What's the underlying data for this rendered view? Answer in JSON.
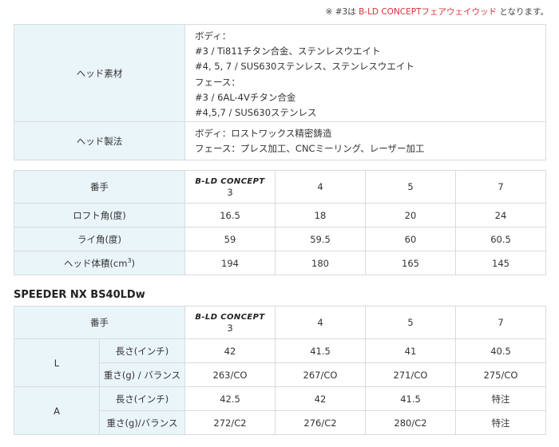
{
  "note": {
    "prefix": "※ #3は ",
    "highlight": "B-LD CONCEPTフェアウェイウッド",
    "suffix": " となります。"
  },
  "spec_table": {
    "rows": [
      {
        "label": "ヘッド素材",
        "lines": [
          "ボディ：",
          "#3 / Ti811チタン合金、ステンレスウエイト",
          "#4, 5, 7 / SUS630ステンレス、ステンレスウエイト",
          "フェース：",
          "#3 / 6AL-4Vチタン合金",
          "#4,5,7 / SUS630ステンレス"
        ]
      },
      {
        "label": "ヘッド製法",
        "lines": [
          "ボディ：ロストワックス精密鋳造",
          "フェース：プレス加工、CNCミーリング、レーザー加工"
        ]
      }
    ]
  },
  "head_table": {
    "header_label": "番手",
    "logo_text": "B-LD CONCEPT",
    "columns": [
      "3",
      "4",
      "5",
      "7"
    ],
    "rows": [
      {
        "label": "ロフト角(度)",
        "values": [
          "16.5",
          "18",
          "20",
          "24"
        ]
      },
      {
        "label": "ライ角(度)",
        "values": [
          "59",
          "59.5",
          "60",
          "60.5"
        ]
      },
      {
        "label_prefix": "ヘッド体積(cm",
        "label_sup": "3",
        "label_suffix": ")",
        "values": [
          "194",
          "180",
          "165",
          "145"
        ]
      }
    ]
  },
  "shaft_section": {
    "title": "SPEEDER NX BS40LDw",
    "header_label": "番手",
    "logo_text": "B-LD CONCEPT",
    "columns": [
      "3",
      "4",
      "5",
      "7"
    ],
    "groups": [
      {
        "flex": "L",
        "rows": [
          {
            "label": "長さ(インチ)",
            "values": [
              "42",
              "41.5",
              "41",
              "40.5"
            ]
          },
          {
            "label": "重さ(g) / バランス",
            "values": [
              "263/CO",
              "267/CO",
              "271/CO",
              "275/CO"
            ]
          }
        ]
      },
      {
        "flex": "A",
        "rows": [
          {
            "label": "長さ(インチ)",
            "values": [
              "42.5",
              "42",
              "41.5",
              "特注"
            ]
          },
          {
            "label": "重さ(g)/バランス",
            "values": [
              "272/C2",
              "276/C2",
              "280/C2",
              "特注"
            ]
          }
        ]
      }
    ]
  }
}
